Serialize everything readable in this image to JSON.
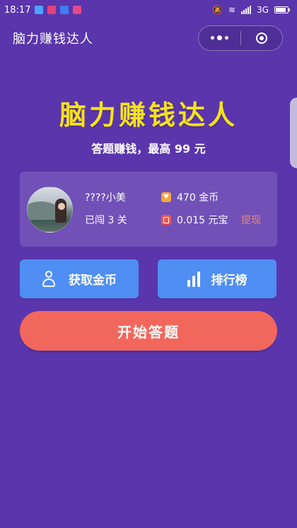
{
  "status_bar": {
    "time": "18:17",
    "network": "3G",
    "app_icon_colors": [
      "#4aa3ff",
      "#e2427a",
      "#3d7ef2",
      "#e24a8a"
    ]
  },
  "navbar": {
    "title": "脑力赚钱达人",
    "more_icon": "more-dots-icon",
    "close_icon": "target-circle-icon"
  },
  "hero": {
    "title": "脑力赚钱达人",
    "subtitle": "答题赚钱，最高 99 元"
  },
  "user": {
    "name": "????小美",
    "level": "已闯 3 关",
    "coins": "470 金币",
    "yuan": "0.015 元宝",
    "withdraw": "提现"
  },
  "actions": {
    "get_coins": "获取金币",
    "leaderboard": "排行榜",
    "start": "开始答题"
  },
  "colors": {
    "background": "#5a35ac",
    "hero_title": "#f7e21a",
    "blue_button": "#4f8ef3",
    "start_button": "#f2675c",
    "withdraw": "#f0885a"
  }
}
